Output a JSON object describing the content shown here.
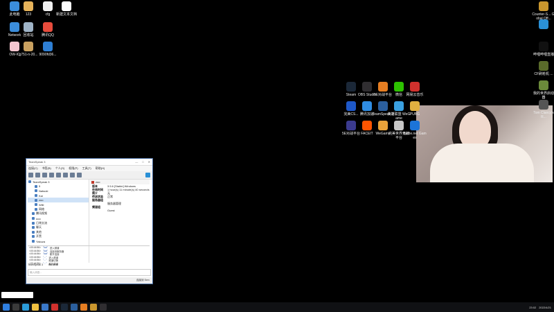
{
  "desktop_left": [
    {
      "label": "此电脑",
      "color": "#3b8ddb"
    },
    {
      "label": "123",
      "color": "#e6b35a"
    },
    {
      "label": "cfg",
      "color": "#f0f0f0"
    },
    {
      "label": "新建文本文档",
      "color": "#ffffff"
    },
    {
      "label": "Network",
      "color": "#3b8ddb"
    },
    {
      "label": "回收站",
      "color": "#9fb4c7"
    },
    {
      "label": "腾讯QQ",
      "color": "#e74c3c"
    },
    {
      "label": "OW-IC",
      "color": "#f4c6d0"
    },
    {
      "label": "g751-n-20...",
      "color": "#c9a160"
    },
    {
      "label": "9090fd36...",
      "color": "#2e7fd4"
    }
  ],
  "desktop_right_col": [
    {
      "label": "Counter-S... Global Off...",
      "color": "#c9962e"
    },
    {
      "label": "",
      "color": "#2a90d6"
    },
    {
      "label": "哔哩哔哩直播",
      "color": "#111111"
    },
    {
      "label": "CF刷枪机 ...",
      "color": "#5a6b2a"
    },
    {
      "label": "我的世界启动器",
      "color": "#6b8a3a"
    },
    {
      "label": "Tom Clancy's R...",
      "color": "#555555"
    }
  ],
  "desktop_right_grid": [
    {
      "label": "Steam",
      "color": "#1b2838"
    },
    {
      "label": "OBS Studio",
      "color": "#302e31"
    },
    {
      "label": "5E对战平台",
      "color": "#e67e22"
    },
    {
      "label": "微信",
      "color": "#2dc100"
    },
    {
      "label": "网易云音乐",
      "color": "#d0312d"
    },
    {
      "label": "完美CS...",
      "color": "#1e58c8"
    },
    {
      "label": "腾讯加速",
      "color": "#2f8de4"
    },
    {
      "label": "TeamSpeak 3",
      "color": "#2b5f9e"
    },
    {
      "label": "英雄联盟 WeGame",
      "color": "#3aa0e0"
    },
    {
      "label": "PUBG",
      "color": "#e0b040"
    },
    {
      "label": "5E对战平台",
      "color": "#3b3b8f"
    },
    {
      "label": "FACEIT",
      "color": "#ff5500"
    },
    {
      "label": "WeGame",
      "color": "#e8a23a"
    },
    {
      "label": "完美世界竞技平台",
      "color": "#c7c7c7"
    },
    {
      "label": "Battle.net Games",
      "color": "#1c74d8"
    }
  ],
  "teamspeak": {
    "title": "TeamSpeak 3",
    "menu": [
      "连接(C)",
      "书签(B)",
      "个人(S)",
      "权限(P)",
      "工具(T)",
      "帮助(H)"
    ],
    "tree": [
      {
        "label": "TeamSpeak 3",
        "sel": false
      },
      {
        "label": "5",
        "sel": false
      },
      {
        "label": "Natsuki",
        "sel": false
      },
      {
        "label": "Kai",
        "sel": false
      },
      {
        "label": "zoo",
        "sel": true
      },
      {
        "label": "Willi",
        "sel": false
      },
      {
        "label": "网络",
        "sel": false
      },
      {
        "label": "腾讯视频",
        "sel": false
      },
      {
        "label": "ooo",
        "sel": false
      },
      {
        "label": "日常交流",
        "sel": false
      },
      {
        "label": "聊天",
        "sel": false
      },
      {
        "label": "其他",
        "sel": false
      },
      {
        "label": "开黑",
        "sel": false
      },
      {
        "label": "Yakuza",
        "sel": false
      }
    ],
    "info_header": "zoo",
    "info_lines": [
      {
        "k": "版本",
        "v": "3.5.6 [Stable] Windows"
      },
      {
        "k": "在线时间",
        "v": "1 hour(s) 11 minute(s) 40 seconds"
      },
      {
        "k": "简介",
        "v": "无"
      },
      {
        "k": "传送状态",
        "v": "正常"
      },
      {
        "k": "服务器组",
        "v": ""
      },
      {
        "k": "",
        "v": "服务器管理"
      },
      {
        "k": "频道组",
        "v": ""
      },
      {
        "k": "",
        "v": "Guest"
      }
    ],
    "chat": [
      {
        "t": "<00:44:56>",
        "n": "\"kai\"",
        "m": "进入频道"
      },
      {
        "t": "<00:44:56>",
        "n": "\"kai\"",
        "m": "连接到服务器"
      },
      {
        "t": "<00:44:56>",
        "n": "\"kai\"",
        "m": "断开连接"
      },
      {
        "t": "<00:44:56>",
        "n": "\"...\"",
        "m": "进入频道"
      },
      {
        "t": "<00:44:56>",
        "n": "\"...\"",
        "m": "频道切换"
      },
      {
        "t": "<00:44:56>",
        "n": "\"...\"",
        "m": "离开频道"
      }
    ],
    "tabs": [
      "TeamSpeak 3",
      "Serverfe"
    ],
    "input_placeholder": "输入消息...",
    "status": "连接到 Serv"
  },
  "notification": {
    "text": ""
  },
  "taskbar": {
    "time": "23:02",
    "date": "2022/4/21"
  }
}
